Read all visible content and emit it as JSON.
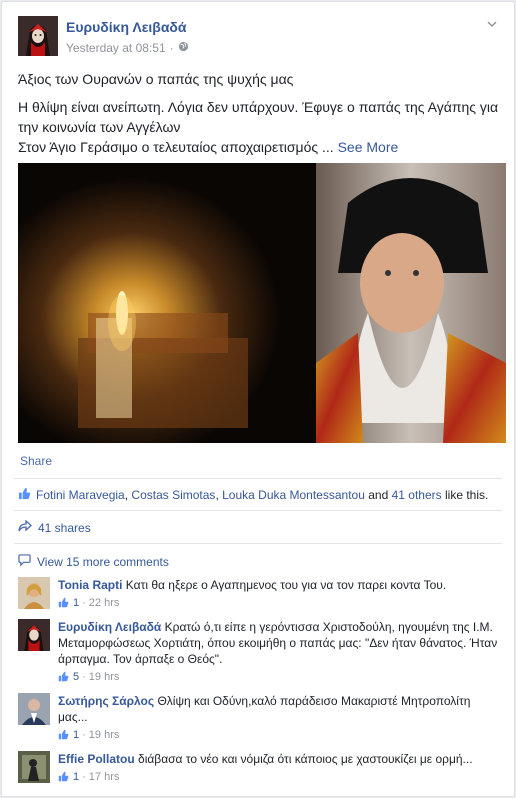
{
  "post": {
    "author": "Ευρυδίκη Λειβαδά",
    "timestamp": "Yesterday at 08:51",
    "separator": "·",
    "line1": "Άξιος των Ουρανών ο παπάς της ψυχής μας",
    "line2": "Η θλίψη είναι ανείπωτη. Λόγια δεν υπάρχουν. Έφυγε ο παπάς της Αγάπης για την κοινωνία των Αγγέλων",
    "line3": "Στον Άγιο Γεράσιμο ο τελευταίος αποχαιρετισμός",
    "ellipsis": "...",
    "see_more": "See More"
  },
  "actions": {
    "share": "Share"
  },
  "likes": {
    "names": [
      "Fotini Maravegia",
      "Costas Simotas",
      "Louka Duka Montessantou"
    ],
    "sep1": ",",
    "sep2": ",",
    "and": "and",
    "others": "41 others",
    "suffix": "like this."
  },
  "shares": {
    "label": "41 shares"
  },
  "comments_link": "View 15 more comments",
  "comments": [
    {
      "name": "Tonia Rapti",
      "text": "Κατι θα ηξερε ο Αγαπημενος του για να τον παρει κοντα Του.",
      "likes": "1",
      "time": "22 hrs"
    },
    {
      "name": "Ευρυδίκη Λειβαδά",
      "text": "Κρατώ ό,τι είπε η γερόντισσα Χριστοδούλη, ηγουμένη της Ι.Μ. Μεταμορφώσεως Χορτιάτη, όπου εκοιμήθη ο παπάς μας: \"Δεν ήταν θάνατος. Ήταν άρπαγμα. Τον άρπαξε ο Θεός\".",
      "likes": "5",
      "time": "19 hrs"
    },
    {
      "name": "Σωτήρης Σάρλος",
      "text": "Θλίψη και Οδύνη,καλό παράδεισο Μακαριστέ Μητροπολίτη μας...",
      "likes": "1",
      "time": "19 hrs"
    },
    {
      "name": "Effie Pollatou",
      "text": "διάβασα το νέο και νόμιζα ότι κάποιος με χαστουκίζει με ορμή...",
      "likes": "1",
      "time": "17 hrs"
    }
  ],
  "meta_sep": "·",
  "colors": {
    "link": "#365899",
    "meta": "#90949c",
    "text": "#1d2129"
  }
}
